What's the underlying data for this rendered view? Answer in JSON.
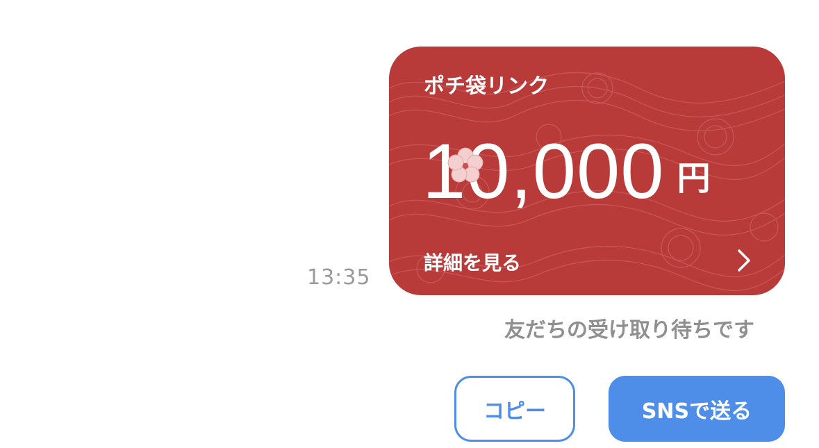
{
  "message": {
    "timestamp": "13:35",
    "status": "友だちの受け取り待ちです"
  },
  "card": {
    "title": "ポチ袋リンク",
    "amount": "10,000",
    "currency": "円",
    "details_label": "詳細を見る",
    "background_color": "#b83b3a",
    "icons": [
      "plum-blossom-icon",
      "chevron-right-icon"
    ]
  },
  "actions": {
    "copy_label": "コピー",
    "sns_label": "SNSで送る",
    "accent_color": "#4f8ee8"
  }
}
